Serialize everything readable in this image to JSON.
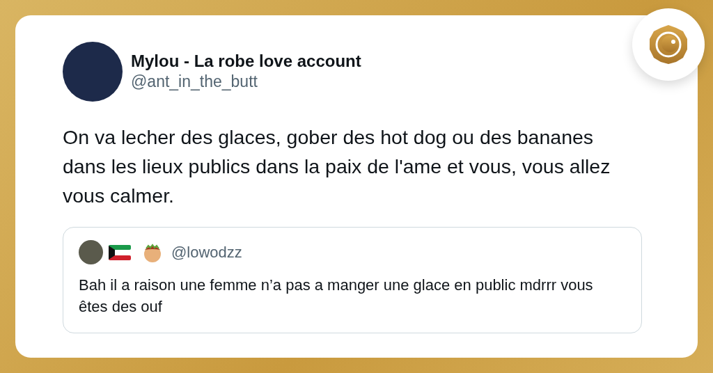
{
  "tweet": {
    "author_name": "Mylou - La robe love account",
    "handle": "@ant_in_the_butt",
    "text": "On va lecher des glaces, gober des hot dog ou des bananes dans les lieux publics dans la paix de l'ame et vous, vous allez vous calmer.",
    "quoted_tweet": {
      "handle": "@lowodzz",
      "text": "Bah il a raison une femme n’a pas a manger une glace en public mdrrr vous êtes des ouf"
    }
  }
}
